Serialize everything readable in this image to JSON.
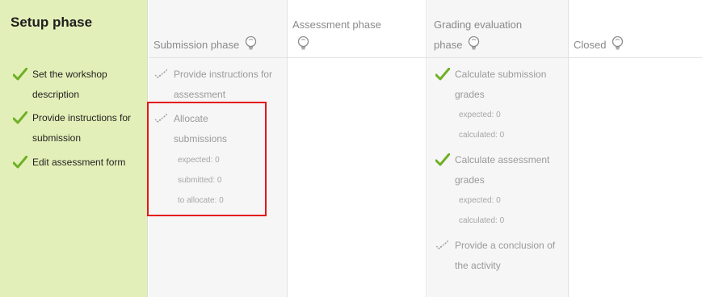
{
  "phases": {
    "setup": {
      "title": "Setup phase",
      "tasks": [
        "Set the workshop description",
        "Provide instructions for submission",
        "Edit assessment form"
      ]
    },
    "submission": {
      "title": "Submission phase",
      "tasks": [
        {
          "label": "Provide instructions for assessment"
        },
        {
          "label": "Allocate submissions",
          "details": [
            "expected: 0",
            "submitted: 0",
            "to allocate: 0"
          ]
        }
      ]
    },
    "assessment": {
      "title": "Assessment phase"
    },
    "grading": {
      "title_line1": "Grading evaluation",
      "title_line2": "phase",
      "tasks": [
        {
          "label": "Calculate submission grades",
          "details": [
            "expected: 0",
            "calculated: 0"
          ]
        },
        {
          "label": "Calculate assessment grades",
          "details": [
            "expected: 0",
            "calculated: 0"
          ]
        },
        {
          "label": "Provide a conclusion of the activity"
        }
      ]
    },
    "closed": {
      "title": "Closed"
    }
  },
  "colors": {
    "active_phase_bg": "#e3efb8",
    "done_check": "#6fb025",
    "highlight": "#e4161b"
  },
  "icons": {
    "done": "check-icon",
    "todo": "todo-checkmark-icon",
    "switch": "lightbulb-icon"
  }
}
